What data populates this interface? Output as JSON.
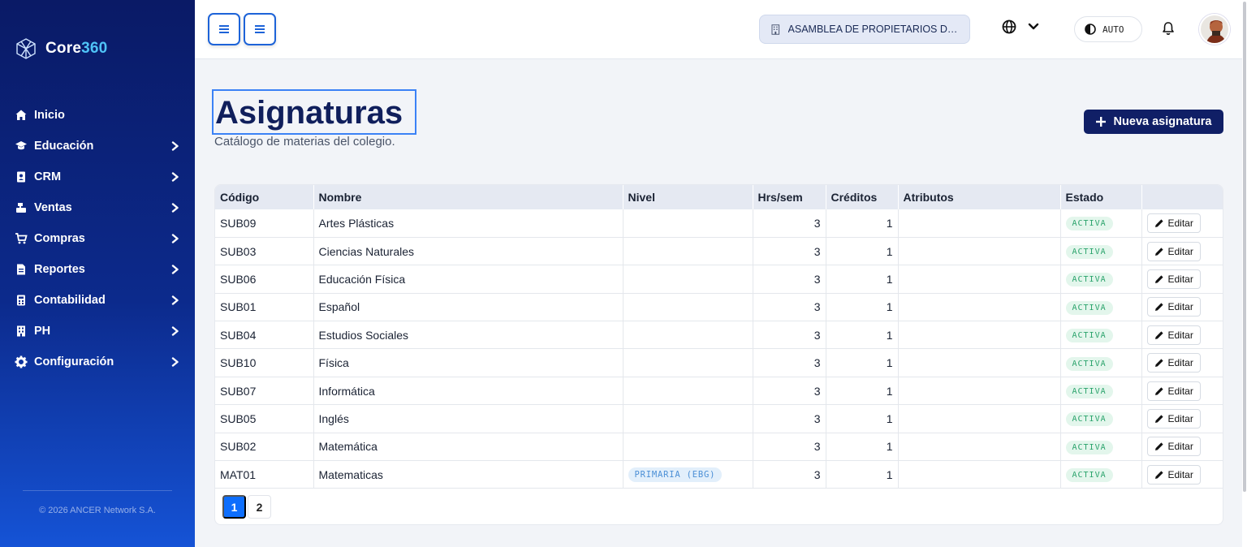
{
  "brand": {
    "name_prefix": "Core",
    "name_suffix": "360"
  },
  "sidebar": {
    "items": [
      {
        "label": "Inicio",
        "icon": "home-icon",
        "has_children": false
      },
      {
        "label": "Educación",
        "icon": "graduation-cap-icon",
        "has_children": true
      },
      {
        "label": "CRM",
        "icon": "contact-book-icon",
        "has_children": true
      },
      {
        "label": "Ventas",
        "icon": "cash-register-icon",
        "has_children": true
      },
      {
        "label": "Compras",
        "icon": "shopping-cart-icon",
        "has_children": true
      },
      {
        "label": "Reportes",
        "icon": "report-file-icon",
        "has_children": true
      },
      {
        "label": "Contabilidad",
        "icon": "calculator-icon",
        "has_children": true
      },
      {
        "label": "PH",
        "icon": "building-icon",
        "has_children": true
      },
      {
        "label": "Configuración",
        "icon": "gear-icon",
        "has_children": true
      }
    ],
    "copyright": "© 2026 ANCER Network S.A."
  },
  "topbar": {
    "org_selector": "ASAMBLEA DE PROPIETARIOS DE ...",
    "theme_label": "AUTO"
  },
  "page": {
    "title": "Asignaturas",
    "subtitle": "Catálogo de materias del colegio.",
    "new_button": "Nueva asignatura"
  },
  "table": {
    "headers": [
      "Código",
      "Nombre",
      "Nivel",
      "Hrs/sem",
      "Créditos",
      "Atributos",
      "Estado",
      ""
    ],
    "edit_label": "Editar",
    "rows": [
      {
        "code": "SUB09",
        "name": "Artes Plásticas",
        "level": "",
        "hours": "3",
        "credits": "1",
        "attributes": "",
        "status": "ACTIVA"
      },
      {
        "code": "SUB03",
        "name": "Ciencias Naturales",
        "level": "",
        "hours": "3",
        "credits": "1",
        "attributes": "",
        "status": "ACTIVA"
      },
      {
        "code": "SUB06",
        "name": "Educación Física",
        "level": "",
        "hours": "3",
        "credits": "1",
        "attributes": "",
        "status": "ACTIVA"
      },
      {
        "code": "SUB01",
        "name": "Español",
        "level": "",
        "hours": "3",
        "credits": "1",
        "attributes": "",
        "status": "ACTIVA"
      },
      {
        "code": "SUB04",
        "name": "Estudios Sociales",
        "level": "",
        "hours": "3",
        "credits": "1",
        "attributes": "",
        "status": "ACTIVA"
      },
      {
        "code": "SUB10",
        "name": "Física",
        "level": "",
        "hours": "3",
        "credits": "1",
        "attributes": "",
        "status": "ACTIVA"
      },
      {
        "code": "SUB07",
        "name": "Informática",
        "level": "",
        "hours": "3",
        "credits": "1",
        "attributes": "",
        "status": "ACTIVA"
      },
      {
        "code": "SUB05",
        "name": "Inglés",
        "level": "",
        "hours": "3",
        "credits": "1",
        "attributes": "",
        "status": "ACTIVA"
      },
      {
        "code": "SUB02",
        "name": "Matemática",
        "level": "",
        "hours": "3",
        "credits": "1",
        "attributes": "",
        "status": "ACTIVA"
      },
      {
        "code": "MAT01",
        "name": "Matematicas",
        "level": "PRIMARIA (EBG)",
        "hours": "3",
        "credits": "1",
        "attributes": "",
        "status": "ACTIVA"
      }
    ]
  },
  "pagination": {
    "pages": [
      "1",
      "2"
    ],
    "current": "1"
  },
  "colors": {
    "sidebar_top": "#0a1a66",
    "sidebar_bottom": "#1553d6",
    "primary": "#101f66",
    "accent": "#0d6efd",
    "status_active": "#2aa36b"
  }
}
